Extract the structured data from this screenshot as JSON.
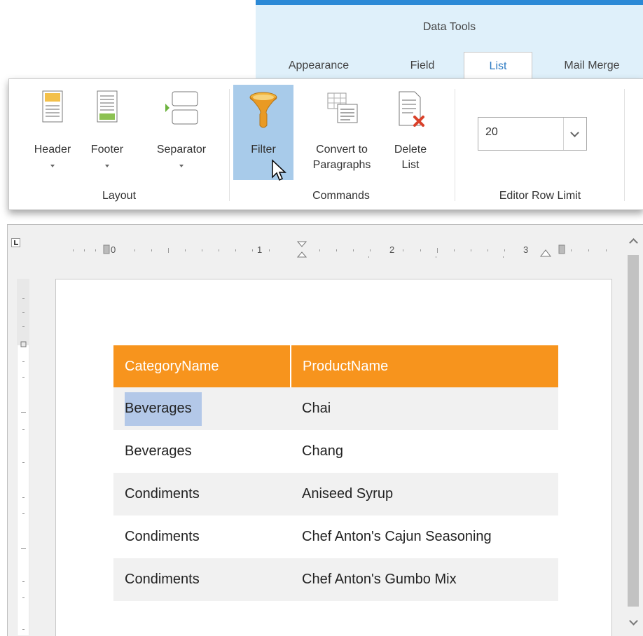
{
  "ribbon": {
    "context_title": "Data Tools",
    "tabs": [
      {
        "label": "Appearance"
      },
      {
        "label": "Field"
      },
      {
        "label": "List",
        "active": true
      },
      {
        "label": "Mail Merge"
      }
    ],
    "groups": {
      "layout": {
        "label": "Layout",
        "buttons": [
          {
            "label": "Header"
          },
          {
            "label": "Footer"
          },
          {
            "label": "Separator"
          }
        ]
      },
      "commands": {
        "label": "Commands",
        "buttons": [
          {
            "label": "Filter"
          },
          {
            "label1": "Convert to",
            "label2": "Paragraphs"
          },
          {
            "label1": "Delete",
            "label2": "List"
          }
        ]
      },
      "row_limit": {
        "label": "Editor Row Limit",
        "value": "20"
      }
    }
  },
  "ruler": {
    "marks": [
      "0",
      "1",
      "2",
      "3"
    ]
  },
  "table": {
    "headers": [
      "CategoryName",
      "ProductName"
    ],
    "rows": [
      [
        "Beverages",
        "Chai"
      ],
      [
        "Beverages",
        "Chang"
      ],
      [
        "Condiments",
        "Aniseed Syrup"
      ],
      [
        "Condiments",
        "Chef Anton's Cajun Seasoning"
      ],
      [
        "Condiments",
        "Chef Anton's Gumbo Mix"
      ]
    ]
  },
  "colors": {
    "header_bg": "#f7941d",
    "selection": "#b3c8e8",
    "highlight_button": "#a8cbea",
    "tab_accent": "#2b89d6"
  }
}
